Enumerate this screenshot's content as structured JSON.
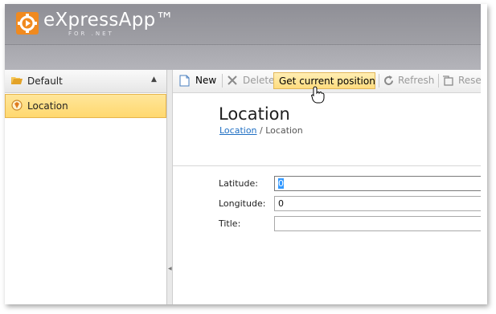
{
  "app": {
    "title": "eXpressApp™",
    "subtitle": "FOR .NET",
    "brand_color": "#f08a1f"
  },
  "navigation": {
    "group_label": "Default",
    "group_icon": "folder-open-icon",
    "items": [
      {
        "label": "Location",
        "icon": "location-icon",
        "selected": true
      }
    ]
  },
  "toolbar": {
    "buttons": [
      {
        "label": "New",
        "icon": "new-document-icon",
        "enabled": true
      },
      {
        "label": "Delete",
        "icon": "delete-icon",
        "enabled": false
      },
      {
        "label": "Get current position",
        "highlighted": true,
        "enabled": true
      },
      {
        "label": "Refresh",
        "icon": "refresh-icon",
        "enabled": false
      },
      {
        "label": "Rese",
        "icon": "reset-icon",
        "enabled": false
      }
    ]
  },
  "view": {
    "title": "Location",
    "breadcrumb": {
      "link": "Location",
      "separator": " / ",
      "current": "Location"
    }
  },
  "form": {
    "fields": [
      {
        "label": "Latitude:",
        "value": "0",
        "focused": true
      },
      {
        "label": "Longitude:",
        "value": "0",
        "focused": false
      },
      {
        "label": "Title:",
        "value": "",
        "focused": false
      }
    ]
  }
}
